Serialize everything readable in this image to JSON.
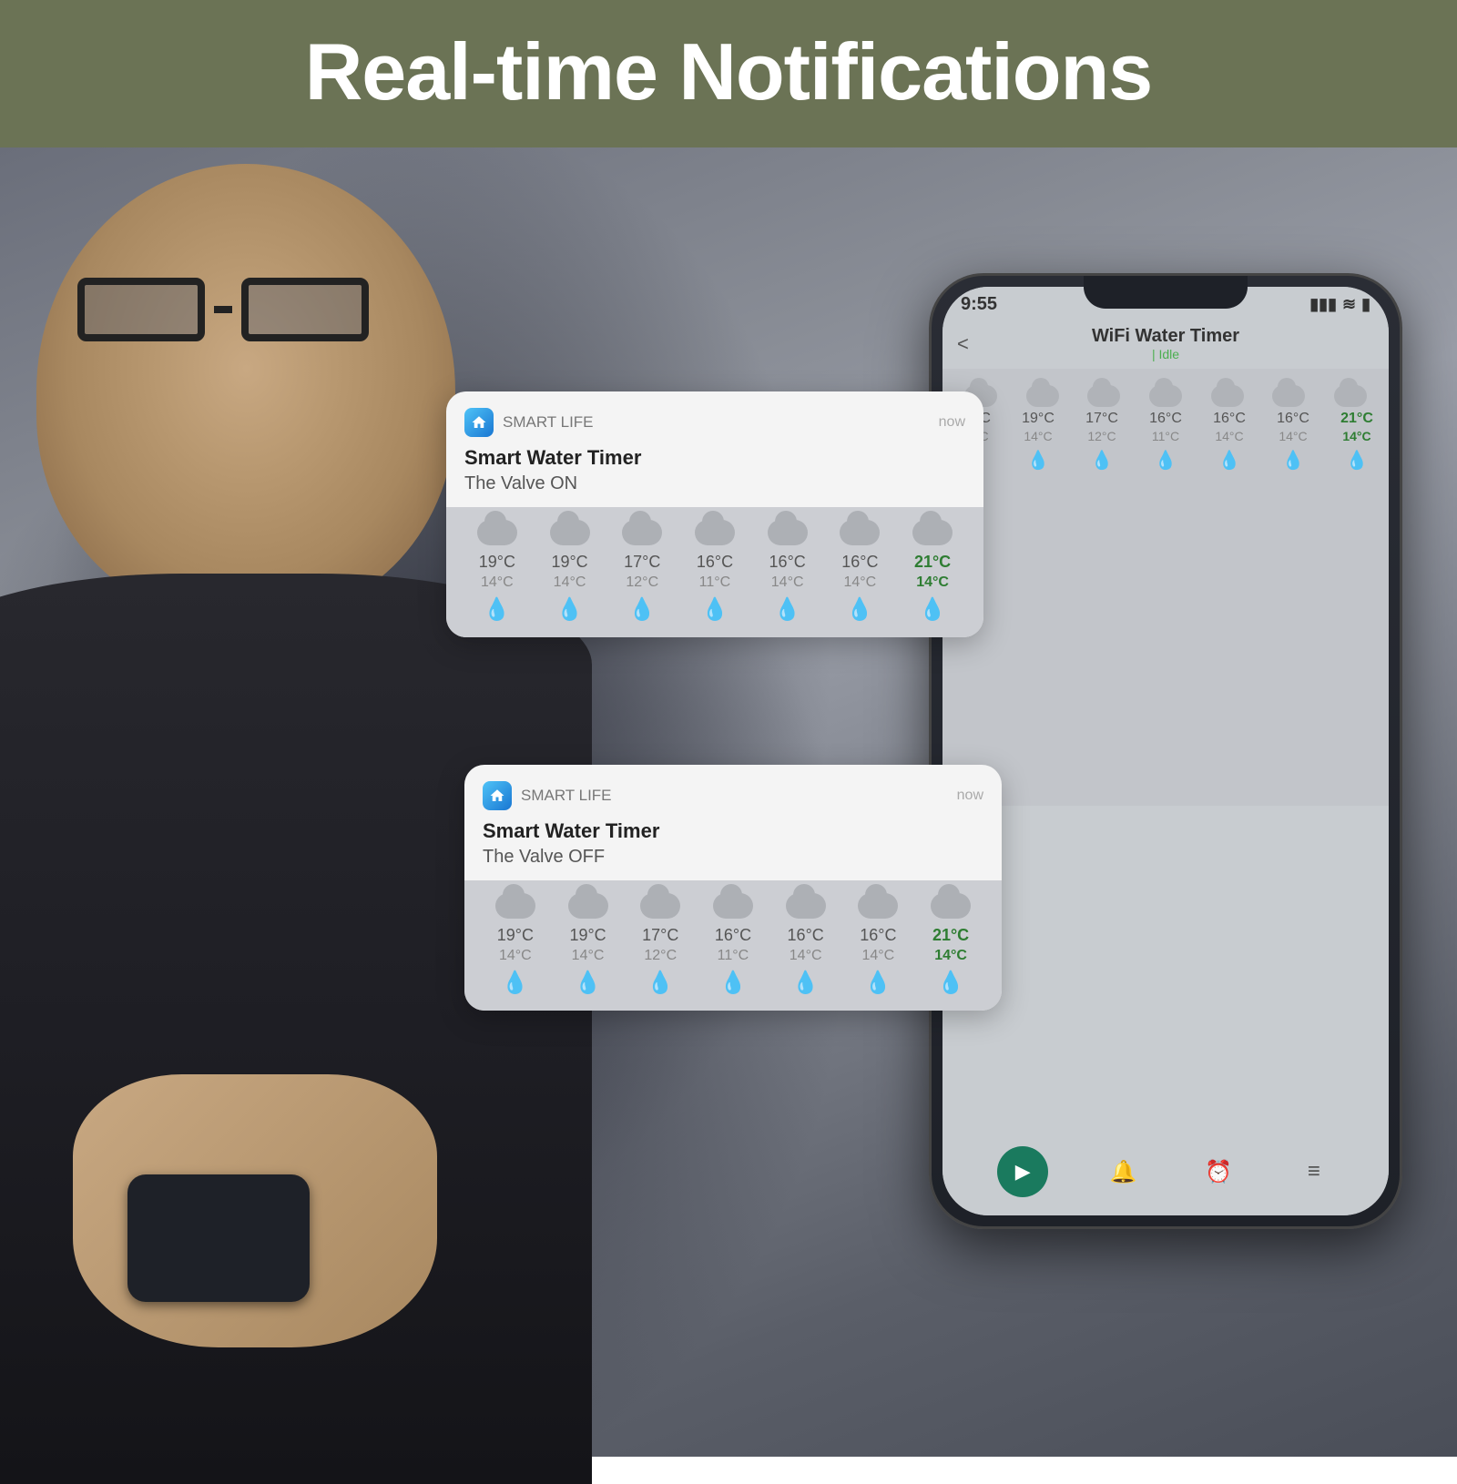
{
  "header": {
    "title": "Real-time Notifications",
    "background_color": "#6b7355"
  },
  "phone": {
    "status_bar": {
      "time": "9:55",
      "signal_icon": "▮▮▮▮",
      "wifi_icon": "WiFi",
      "battery_icon": "🔋"
    },
    "nav": {
      "back": "<",
      "title": "WiFi  Water Timer",
      "subtitle": "| Idle",
      "forward": ">"
    }
  },
  "notification_1": {
    "app_name": "SMART LIFE",
    "time": "now",
    "title": "Smart Water Timer",
    "body": "The Valve ON",
    "app_icon": "🏠"
  },
  "notification_2": {
    "app_name": "SMART LIFE",
    "time": "now",
    "title": "Smart Water Timer",
    "body": "The  Valve OFF",
    "app_icon": "🏠"
  },
  "weather": {
    "temps_high": [
      "19°C",
      "19°C",
      "17°C",
      "16°C",
      "16°C",
      "16°C",
      "21°C"
    ],
    "temps_low": [
      "14°C",
      "14°C",
      "12°C",
      "11°C",
      "14°C",
      "14°C",
      "14°C"
    ],
    "accent_index": 6
  },
  "phone_bottom": {
    "icons": [
      "▶",
      "🔔",
      "⏰",
      "≡"
    ]
  }
}
